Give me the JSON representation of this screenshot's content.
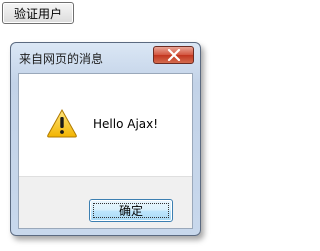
{
  "page": {
    "button_label": "验证用户"
  },
  "dialog": {
    "title": "来自网页的消息",
    "message": "Hello Ajax!",
    "ok_label": "确定",
    "icon": "warning-icon",
    "close_icon": "close-icon"
  }
}
